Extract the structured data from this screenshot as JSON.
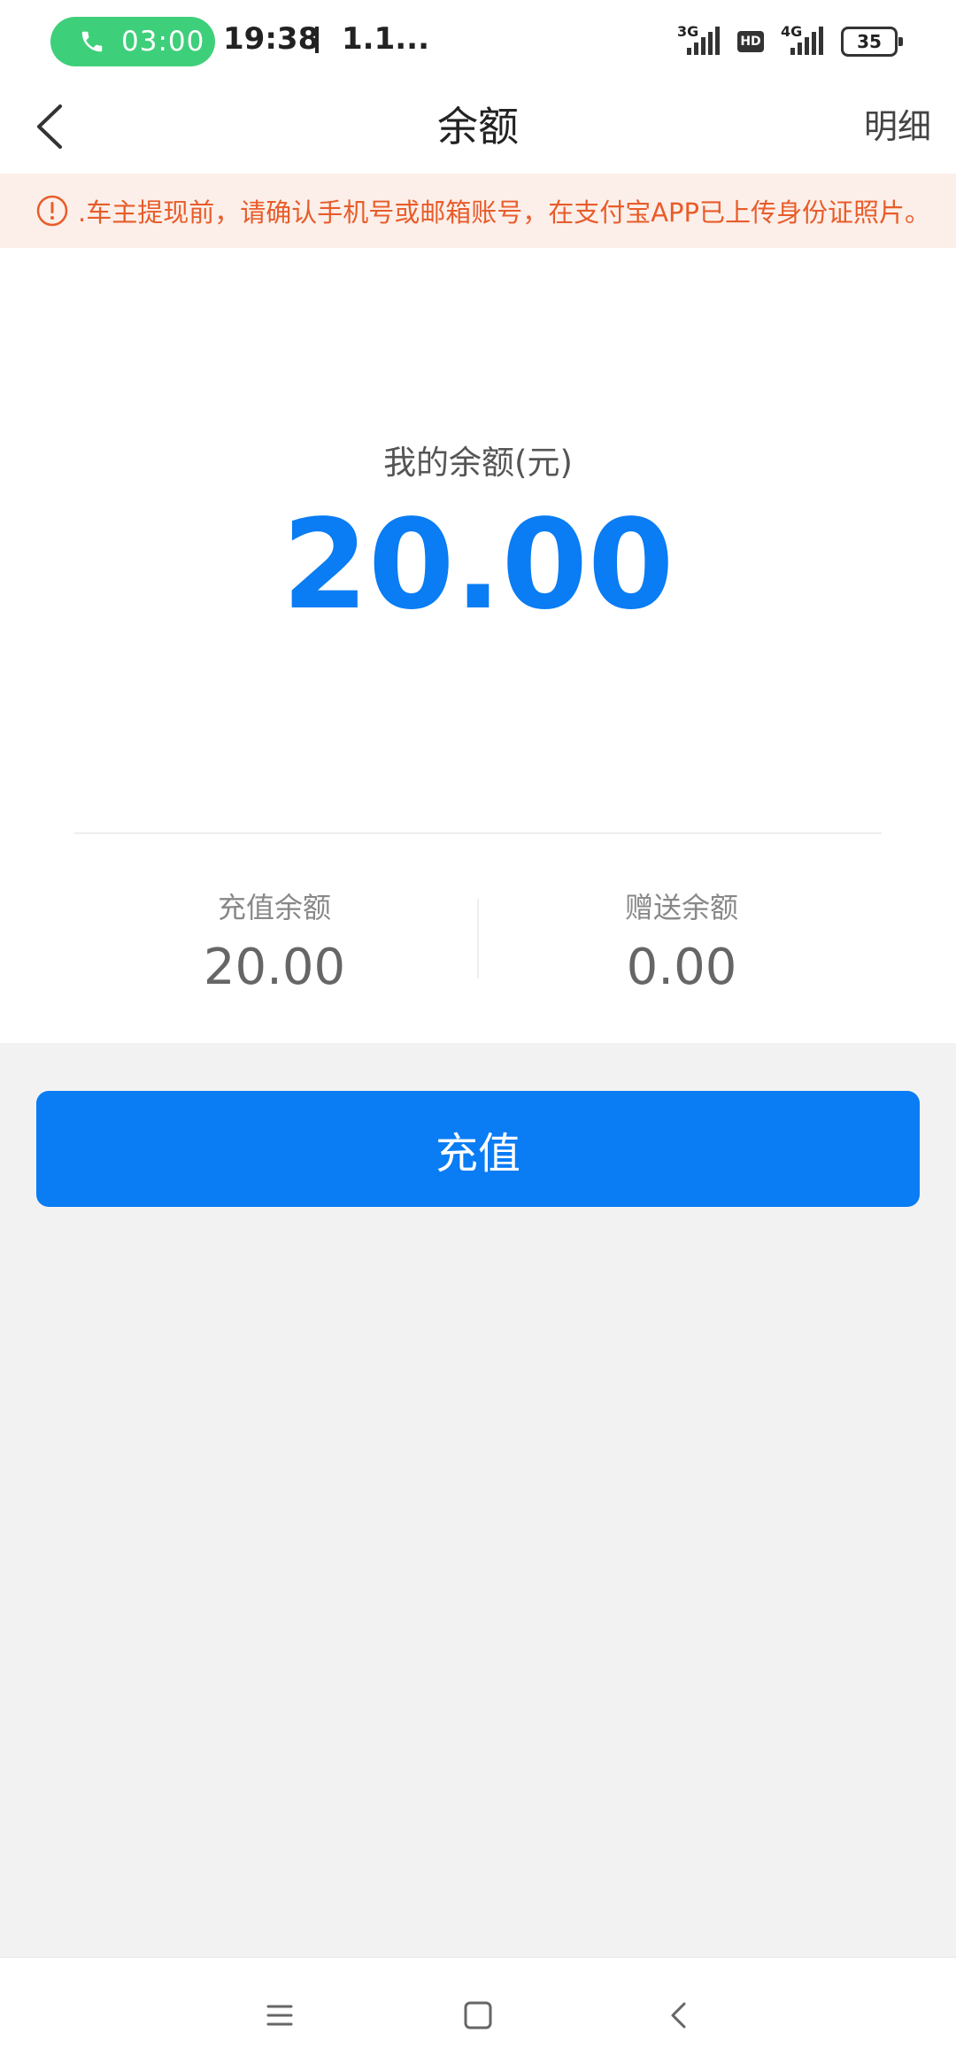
{
  "status_bar": {
    "call_timer": "03:00",
    "time": "19:38",
    "carrier": "1.1...",
    "network1": "3G",
    "hd": "HD",
    "network2": "4G",
    "battery": "35"
  },
  "nav": {
    "title": "余额",
    "detail": "明细"
  },
  "notice": {
    "text": ".车主提现前，请确认手机号或邮箱账号，在支付宝APP已上传身份证照片。"
  },
  "balance": {
    "label": "我的余额(元)",
    "value": "20.00",
    "recharge_label": "充值余额",
    "recharge_value": "20.00",
    "gift_label": "赠送余额",
    "gift_value": "0.00"
  },
  "actions": {
    "recharge_button": "充值"
  },
  "colors": {
    "accent": "#0a7cf4",
    "notice_text": "#e85c2a",
    "notice_bg": "#fcefe9",
    "call_green": "#3ecf7a"
  }
}
